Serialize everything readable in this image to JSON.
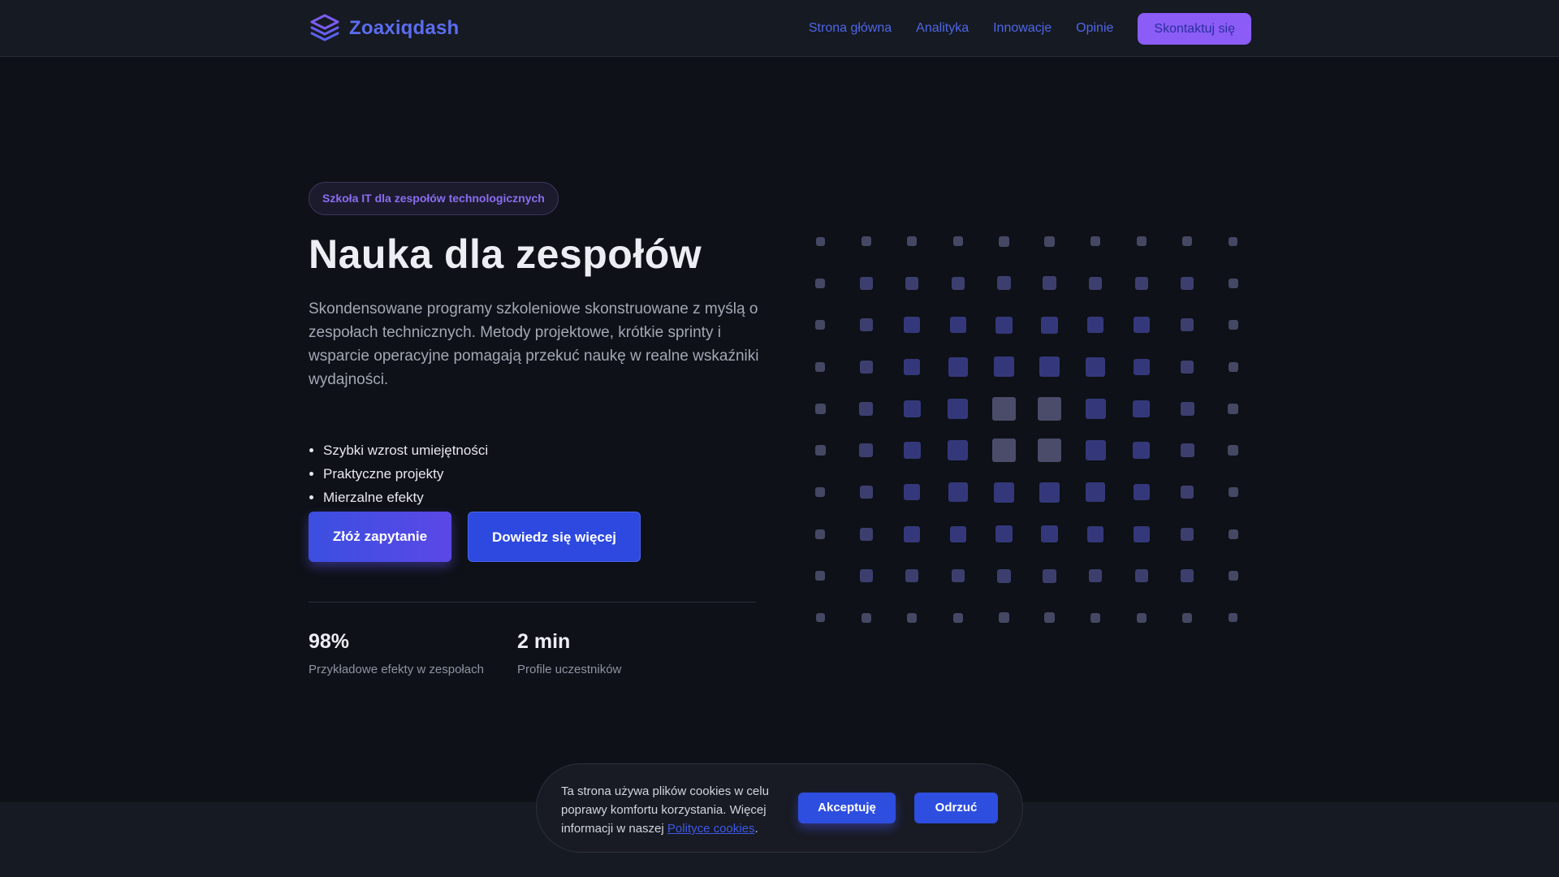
{
  "header": {
    "logo_text": "Zoaxiqdash",
    "nav": [
      {
        "label": "Strona główna"
      },
      {
        "label": "Analityka"
      },
      {
        "label": "Innowacje"
      },
      {
        "label": "Opinie"
      }
    ],
    "cta_label": "Skontaktuj się"
  },
  "hero": {
    "badge": "Szkoła IT dla zespołów technologicznych",
    "title": "Nauka dla zespołów",
    "description": "Skondensowane programy szkoleniowe skonstruowane z myślą o zespołach technicznych. Metody projektowe, krótkie sprinty i wsparcie operacyjne pomagają przekuć naukę w realne wskaźniki wydajności.",
    "features": [
      "Szybki wzrost umiejętności",
      "Praktyczne projekty",
      "Mierzalne efekty"
    ],
    "primary_button": "Złóż zapytanie",
    "secondary_button": "Dowiedz się więcej",
    "stats": [
      {
        "value": "98%",
        "label": "Przykładowe efekty w zespołach"
      },
      {
        "value": "2 min",
        "label": "Profile uczestników"
      }
    ]
  },
  "cookie": {
    "text": "Ta strona używa plików cookies w celu poprawy komfortu korzystania. Więcej informacji w naszej ",
    "link": "Polityce cookies",
    "suffix": ".",
    "accept": "Akceptuję",
    "reject": "Odrzuć"
  },
  "colors": {
    "accent": "#4f66e8",
    "brand_purple": "#8b5cf6",
    "background": "#0e1117",
    "header_bg": "#161a22"
  },
  "icons": {
    "logo": "layers-stack-icon"
  }
}
